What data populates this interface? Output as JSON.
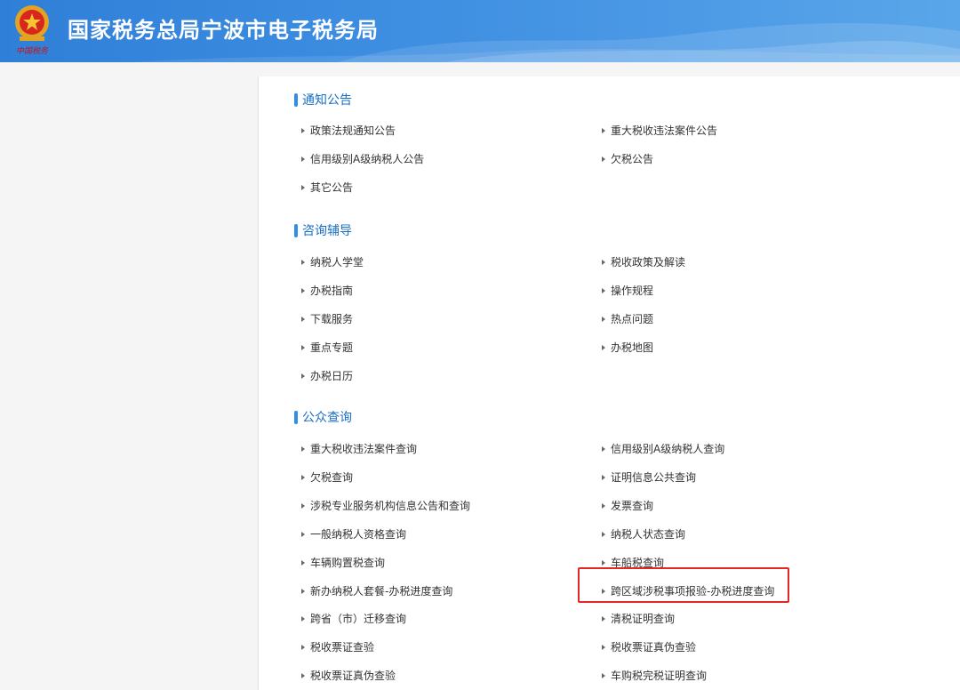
{
  "header": {
    "emblem_text": "中国税务",
    "title": "国家税务总局宁波市电子税务局"
  },
  "sections": [
    {
      "title": "通知公告",
      "items": [
        "政策法规通知公告",
        "重大税收违法案件公告",
        "信用级别A级纳税人公告",
        "欠税公告",
        "其它公告"
      ]
    },
    {
      "title": "咨询辅导",
      "items": [
        "纳税人学堂",
        "税收政策及解读",
        "办税指南",
        "操作规程",
        "下载服务",
        "热点问题",
        "重点专题",
        "办税地图",
        "办税日历"
      ]
    },
    {
      "title": "公众查询",
      "items": [
        "重大税收违法案件查询",
        "信用级别A级纳税人查询",
        "欠税查询",
        "证明信息公共查询",
        "涉税专业服务机构信息公告和查询",
        "发票查询",
        "一般纳税人资格查询",
        "纳税人状态查询",
        "车辆购置税查询",
        "车船税查询",
        "新办纳税人套餐-办税进度查询",
        "跨区域涉税事项报验-办税进度查询",
        "跨省（市）迁移查询",
        "清税证明查询",
        "税收票证查验",
        "税收票证真伪查验",
        "税收票证真伪查验",
        "车购税完税证明查询"
      ]
    }
  ],
  "highlight_color": "#e32626"
}
